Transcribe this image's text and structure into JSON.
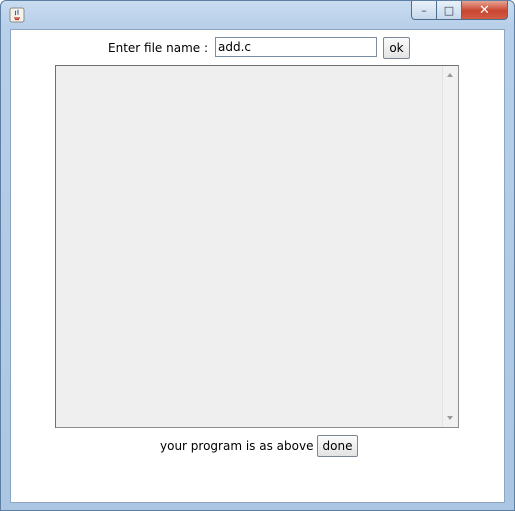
{
  "window": {
    "title": "",
    "controls": {
      "minimize_glyph": "–",
      "maximize_glyph": "□",
      "close_glyph": "✕"
    }
  },
  "form": {
    "filename_label": "Enter file name :",
    "filename_value": "add.c",
    "ok_label": "ok",
    "textarea_content": "",
    "status_text": "your program is as above",
    "done_label": "done"
  },
  "colors": {
    "frame": "#b7cfe9",
    "close_button": "#c8452f",
    "textarea_bg": "#efefef"
  },
  "icons": [
    "java-app-icon",
    "minimize-icon",
    "maximize-icon",
    "close-icon",
    "scroll-up-arrow-icon",
    "scroll-down-arrow-icon"
  ]
}
